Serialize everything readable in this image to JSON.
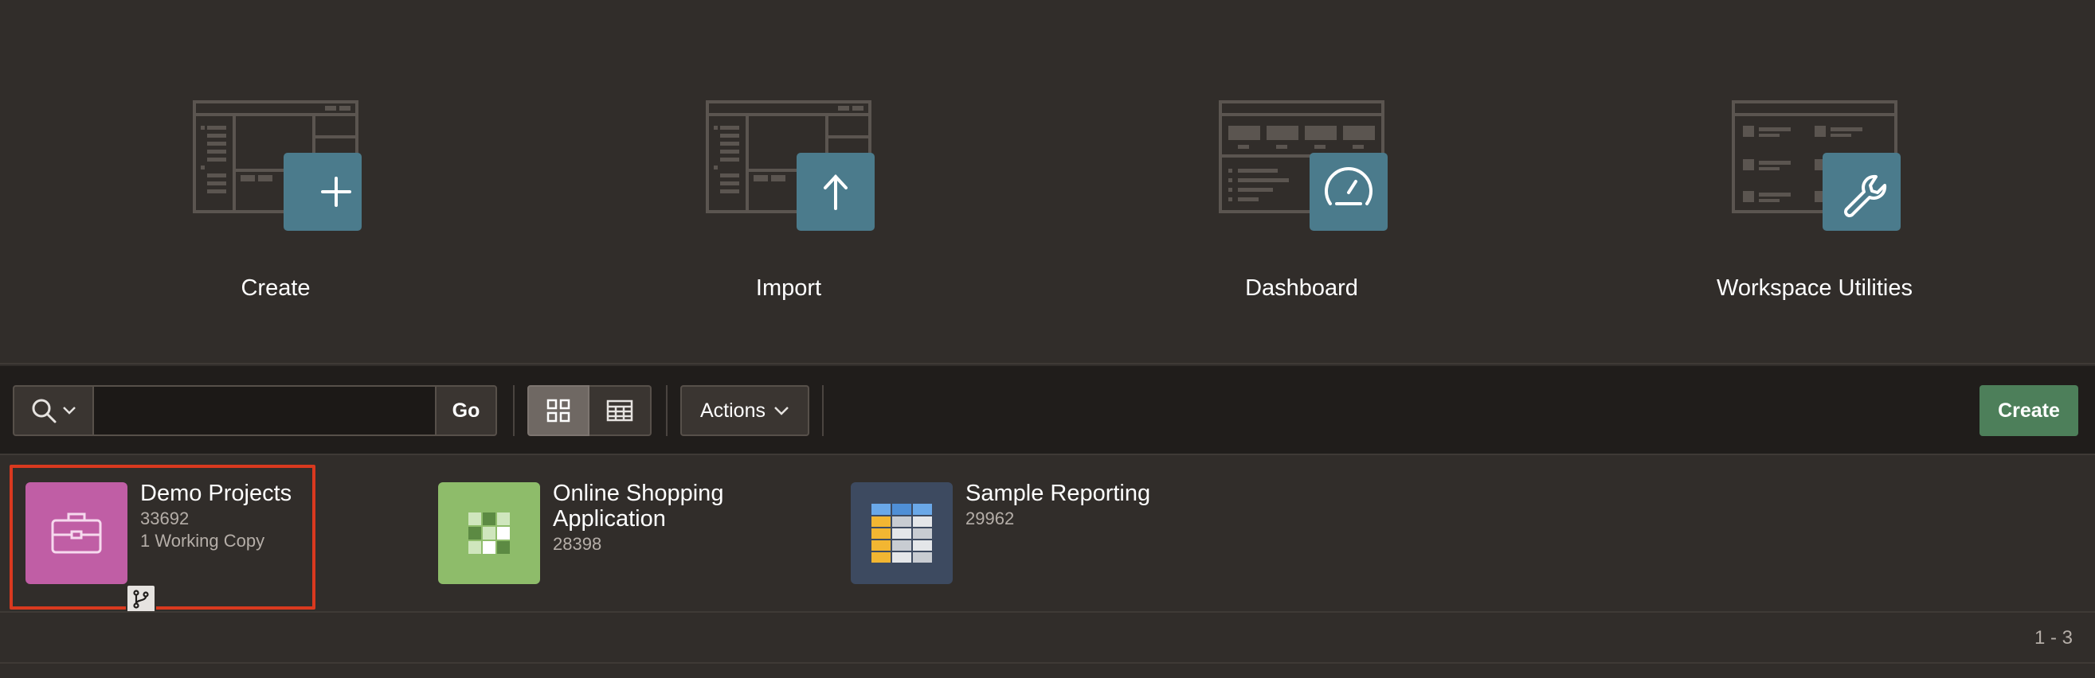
{
  "hero": {
    "tiles": [
      {
        "label": "Create",
        "icon": "plus-icon"
      },
      {
        "label": "Import",
        "icon": "upload-arrow-icon"
      },
      {
        "label": "Dashboard",
        "icon": "speedometer-icon"
      },
      {
        "label": "Workspace Utilities",
        "icon": "wrench-icon"
      }
    ]
  },
  "toolbar": {
    "search_value": "",
    "go_label": "Go",
    "actions_label": "Actions",
    "create_label": "Create"
  },
  "apps": [
    {
      "name": "Demo Projects",
      "id": "33692",
      "extra": "1 Working Copy",
      "icon": "briefcase-icon",
      "color": "#c05ea5",
      "selected": true
    },
    {
      "name": "Online Shopping Application",
      "id": "28398",
      "extra": "",
      "icon": "grid-table-icon",
      "color": "#8ebc6a",
      "selected": false
    },
    {
      "name": "Sample Reporting",
      "id": "29962",
      "extra": "",
      "icon": "report-table-icon",
      "color": "#3d4a60",
      "selected": false
    }
  ],
  "pagination": {
    "range": "1 - 3"
  },
  "colors": {
    "background": "#312d2a",
    "toolbar": "#201d1b",
    "tile_accent": "#4b7b8c",
    "create_button": "#4d7f5a",
    "selection": "#d9391f"
  }
}
